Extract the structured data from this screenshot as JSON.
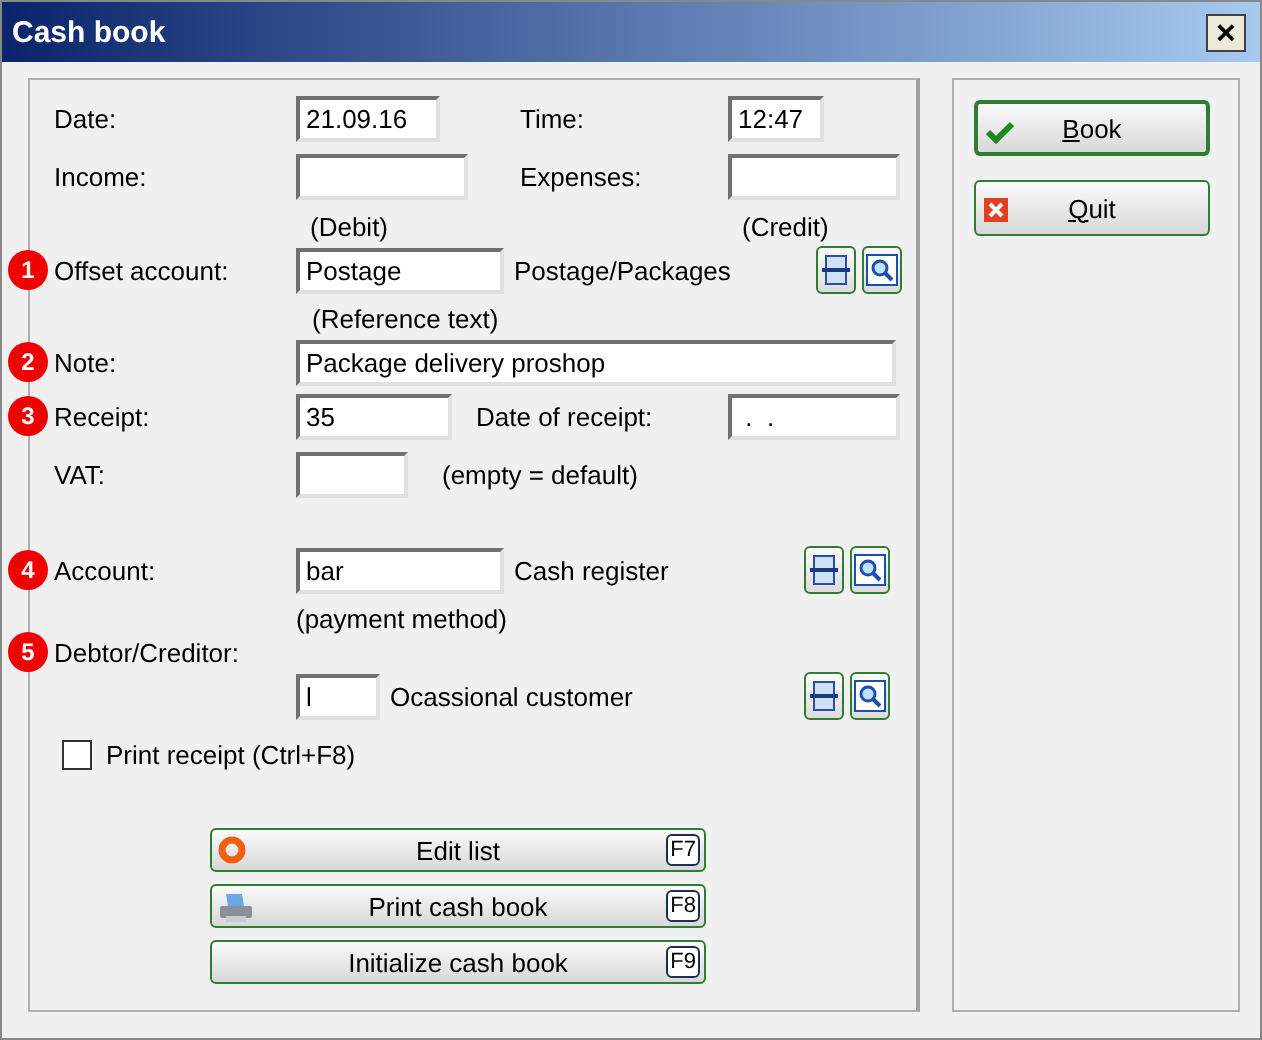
{
  "window": {
    "title": "Cash book",
    "close": "×"
  },
  "date": {
    "label": "Date:",
    "value": "21.09.16"
  },
  "time": {
    "label": "Time:",
    "value": "12:47"
  },
  "income": {
    "label": "Income:",
    "hint": "(Debit)"
  },
  "expenses": {
    "label": "Expenses:",
    "hint": "(Credit)"
  },
  "offset_account": {
    "badge": "1",
    "label": "Offset account:",
    "value": "Postage",
    "description": "Postage/Packages",
    "hint": "(Reference text)"
  },
  "note": {
    "badge": "2",
    "label": "Note:",
    "value": "Package delivery proshop"
  },
  "receipt": {
    "badge": "3",
    "label": "Receipt:",
    "value": "35"
  },
  "date_of_receipt": {
    "label": "Date of receipt:",
    "value": " .  ."
  },
  "vat": {
    "label": "VAT:",
    "hint": "(empty = default)"
  },
  "account": {
    "badge": "4",
    "label": "Account:",
    "value": "bar",
    "description": "Cash register",
    "hint": "(payment method)"
  },
  "debtor_creditor": {
    "badge": "5",
    "label": "Debtor/Creditor:",
    "value": "l",
    "description": "Ocassional customer"
  },
  "print_receipt": {
    "label": "Print receipt (Ctrl+F8)",
    "checked": false
  },
  "actions": [
    {
      "label": "Edit list",
      "key": "F7",
      "kind": "edit"
    },
    {
      "label": "Print cash book",
      "key": "F8",
      "kind": "print"
    },
    {
      "label": "Initialize cash book",
      "key": "F9",
      "kind": "initialize"
    }
  ],
  "side_buttons": [
    {
      "label": "Book",
      "kind": "check"
    },
    {
      "label": "Quit",
      "kind": "cross"
    }
  ]
}
